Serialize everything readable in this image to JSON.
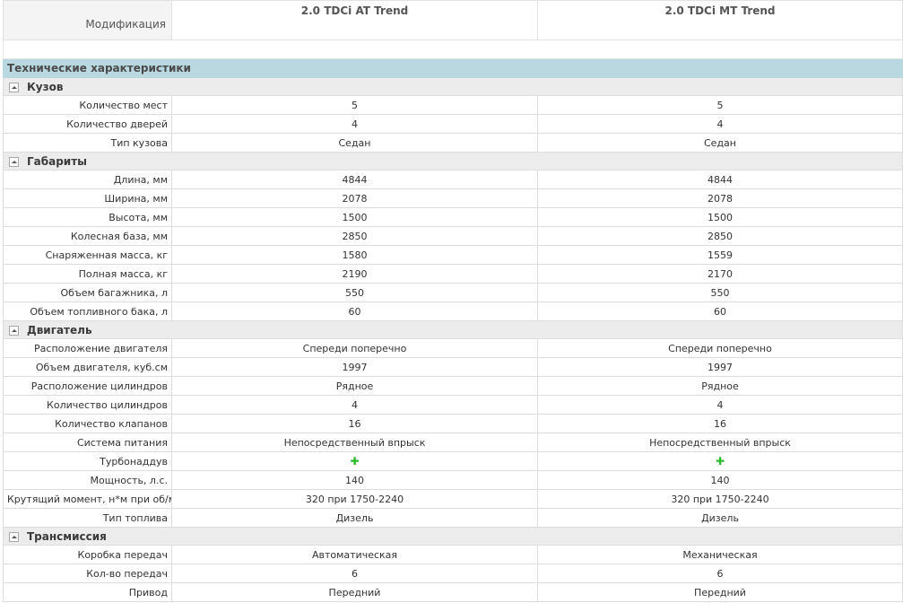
{
  "header": {
    "label": "Модификация",
    "models": [
      "2.0 TDCi AT Trend",
      "2.0 TDCi MT Trend"
    ]
  },
  "tech_title": "Технические характеристики",
  "sections": [
    {
      "title": "Кузов",
      "rows": [
        {
          "label": "Количество мест",
          "values": [
            "5",
            "5"
          ]
        },
        {
          "label": "Количество дверей",
          "values": [
            "4",
            "4"
          ]
        },
        {
          "label": "Тип кузова",
          "values": [
            "Седан",
            "Седан"
          ]
        }
      ]
    },
    {
      "title": "Габариты",
      "rows": [
        {
          "label": "Длина, мм",
          "values": [
            "4844",
            "4844"
          ]
        },
        {
          "label": "Ширина, мм",
          "values": [
            "2078",
            "2078"
          ]
        },
        {
          "label": "Высота, мм",
          "values": [
            "1500",
            "1500"
          ]
        },
        {
          "label": "Колесная база, мм",
          "values": [
            "2850",
            "2850"
          ]
        },
        {
          "label": "Снаряженная масса, кг",
          "values": [
            "1580",
            "1559"
          ]
        },
        {
          "label": "Полная масса, кг",
          "values": [
            "2190",
            "2170"
          ]
        },
        {
          "label": "Объем багажника, л",
          "values": [
            "550",
            "550"
          ]
        },
        {
          "label": "Объем топливного бака, л",
          "values": [
            "60",
            "60"
          ]
        }
      ]
    },
    {
      "title": "Двигатель",
      "rows": [
        {
          "label": "Расположение двигателя",
          "values": [
            "Спереди поперечно",
            "Спереди поперечно"
          ]
        },
        {
          "label": "Объем двигателя, куб.см",
          "values": [
            "1997",
            "1997"
          ]
        },
        {
          "label": "Расположение цилиндров",
          "values": [
            "Рядное",
            "Рядное"
          ]
        },
        {
          "label": "Количество цилиндров",
          "values": [
            "4",
            "4"
          ]
        },
        {
          "label": "Количество клапанов",
          "values": [
            "16",
            "16"
          ]
        },
        {
          "label": "Система питания",
          "values": [
            "Непосредственный впрыск",
            "Непосредственный впрыск"
          ]
        },
        {
          "label": "Турбонаддув",
          "values": [
            "✚",
            "✚"
          ],
          "icon": "plus-icon"
        },
        {
          "label": "Мощность, л.с.",
          "values": [
            "140",
            "140"
          ]
        },
        {
          "label": "Крутящий момент, н*м при об/мин",
          "values": [
            "320 при 1750-2240",
            "320 при 1750-2240"
          ]
        },
        {
          "label": "Тип топлива",
          "values": [
            "Дизель",
            "Дизель"
          ]
        }
      ]
    },
    {
      "title": "Трансмиссия",
      "rows": [
        {
          "label": "Коробка передач",
          "values": [
            "Автоматическая",
            "Механическая"
          ]
        },
        {
          "label": "Кол-во передач",
          "values": [
            "6",
            "6"
          ]
        },
        {
          "label": "Привод",
          "values": [
            "Передний",
            "Передний"
          ]
        }
      ]
    }
  ],
  "colors": {
    "tech_bar": "#b9d8e0",
    "section_bar": "#ececec",
    "plus_green": "#2cbb2c"
  }
}
